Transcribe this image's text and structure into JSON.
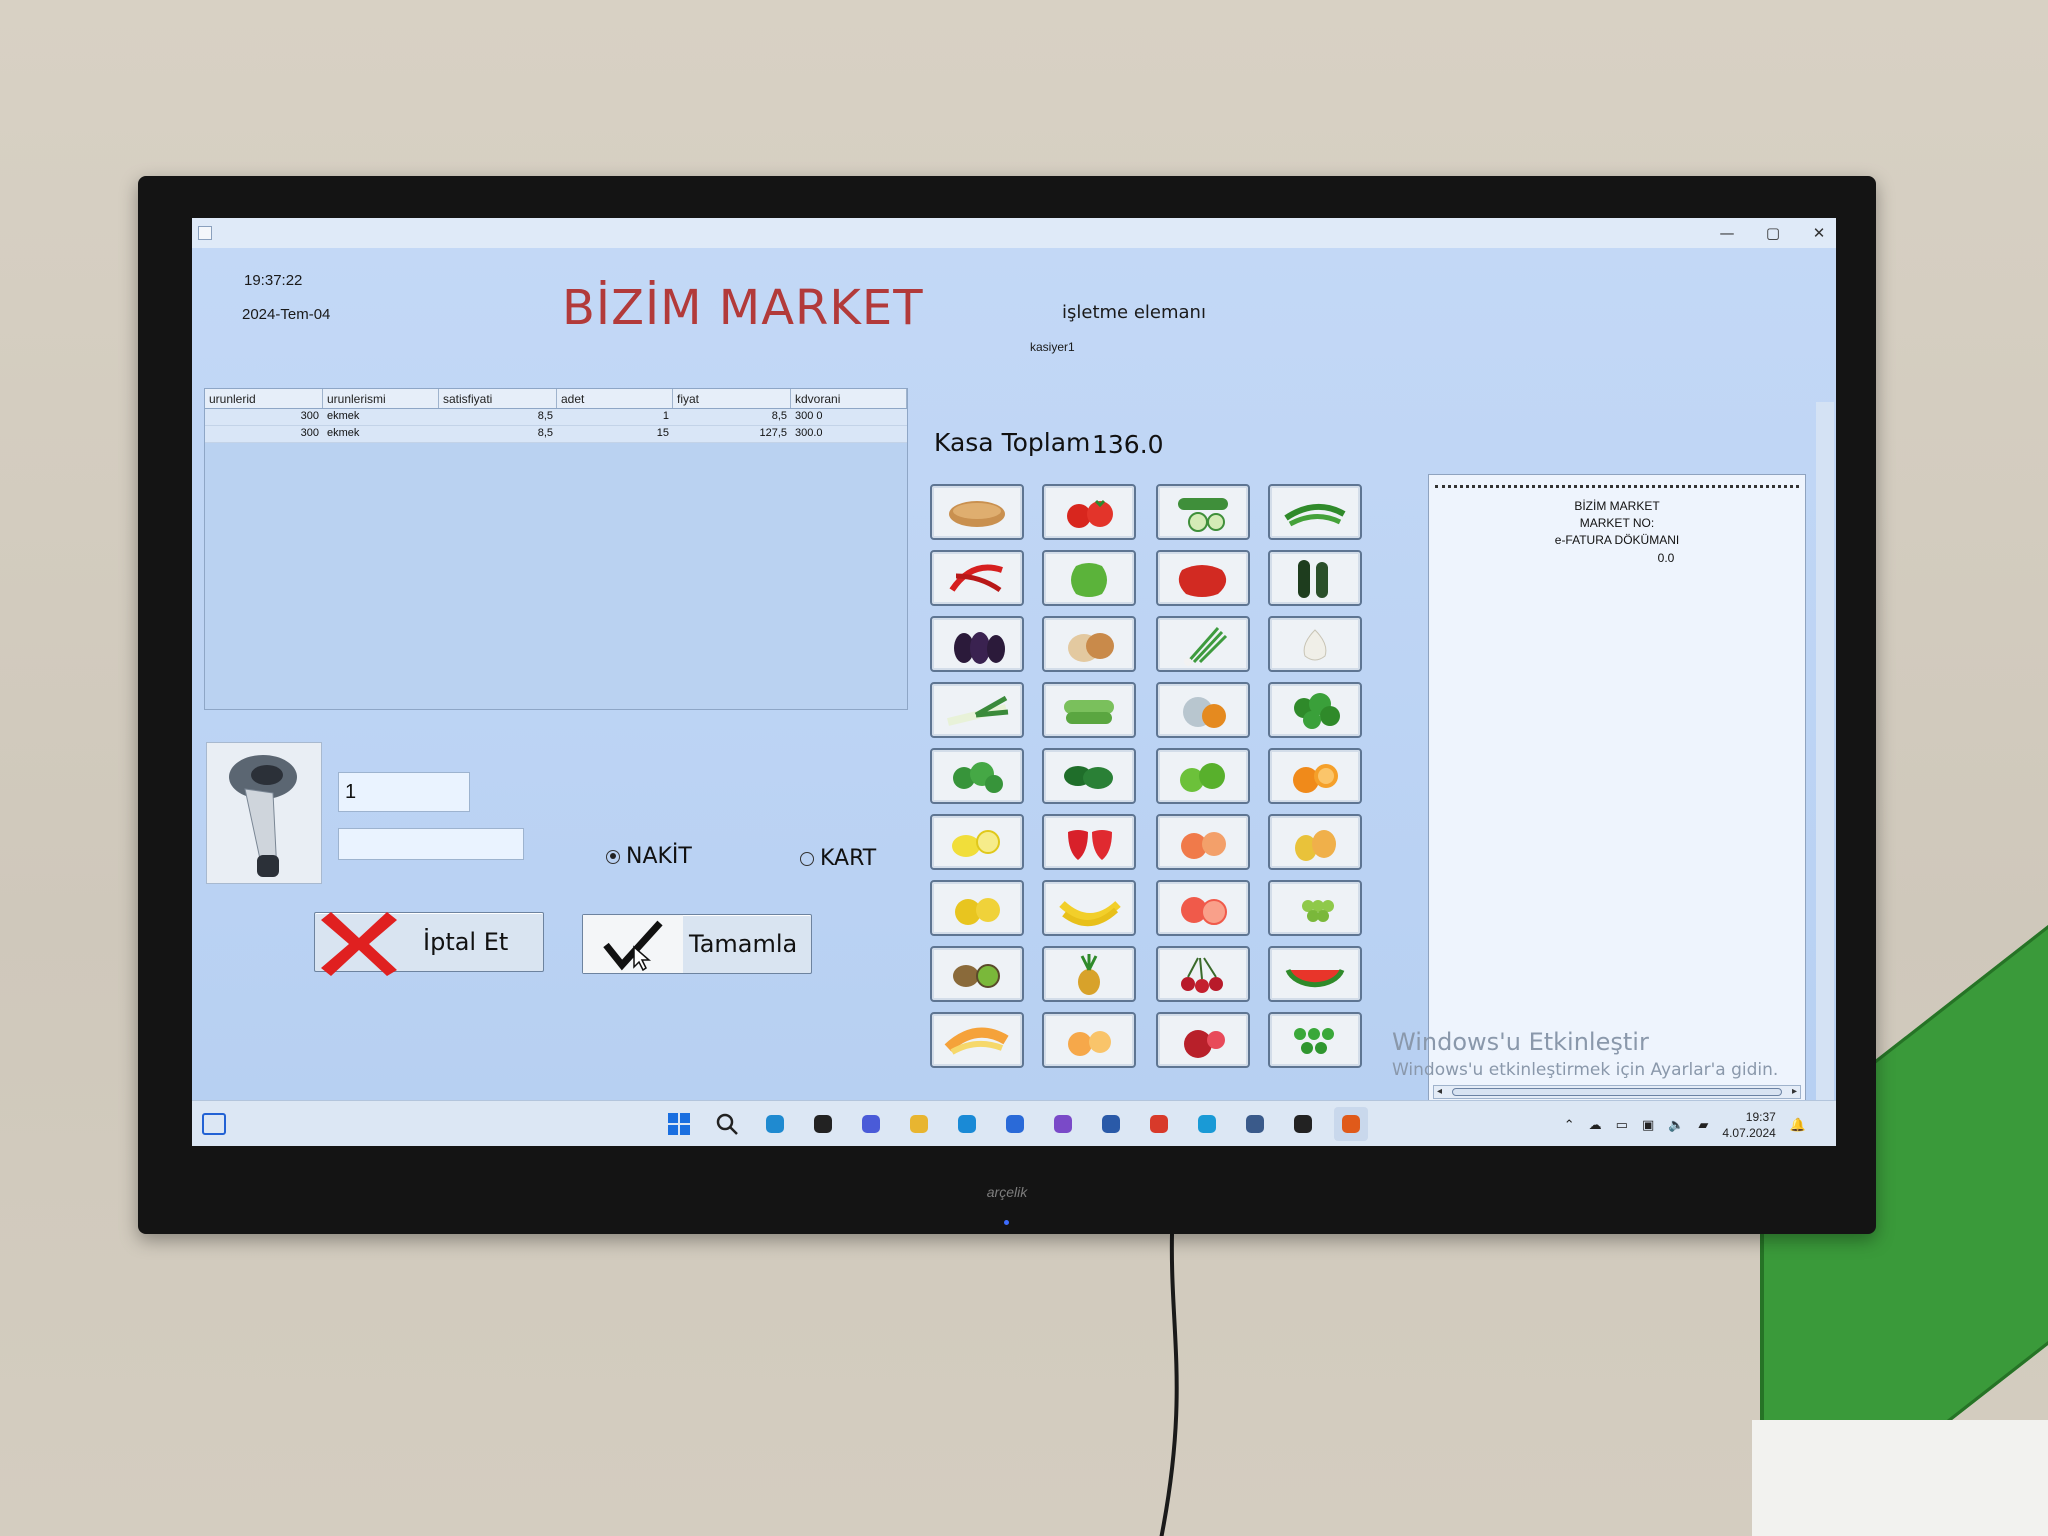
{
  "app": {
    "clock": "19:37:22",
    "date": "2024-Tem-04",
    "title": "BİZİM MARKET",
    "staff_label": "işletme elemanı",
    "staff_name": "kasiyer1"
  },
  "window_controls": {
    "minimize": "—",
    "maximize": "▢",
    "close": "✕"
  },
  "sales_table": {
    "columns": [
      "urunlerid",
      "urunlerismi",
      "satisfiyati",
      "adet",
      "fiyat",
      "kdvorani"
    ],
    "rows": [
      [
        "300",
        "ekmek",
        "8,5",
        "1",
        "8,5",
        "300 0"
      ],
      [
        "300",
        "ekmek",
        "8,5",
        "15",
        "127,5",
        "300.0"
      ]
    ]
  },
  "entry": {
    "quantity": "1",
    "barcode": ""
  },
  "payment": {
    "cash_label": "NAKİT",
    "card_label": "KART",
    "selected": "cash"
  },
  "buttons": {
    "cancel": "İptal Et",
    "complete": "Tamamla"
  },
  "total": {
    "label": "Kasa Toplam",
    "value": "136.0"
  },
  "products": [
    "bread",
    "tomato",
    "cucumber",
    "green-pepper",
    "chili-pepper",
    "bell-pepper",
    "red-pepper",
    "zucchini",
    "eggplant",
    "onion",
    "green-onion",
    "garlic",
    "leek",
    "zucchini-light",
    "pumpkin",
    "parsley",
    "dill",
    "spinach",
    "green-apple",
    "orange",
    "lemon",
    "strawberry",
    "peach",
    "pear",
    "quince",
    "banana",
    "grapefruit",
    "grape",
    "kiwi",
    "pineapple",
    "cherry",
    "watermelon",
    "melon",
    "apricot",
    "pomegranate",
    "peas"
  ],
  "receipt": {
    "line1": "BİZİM MARKET",
    "line2": "MARKET NO:",
    "line3": "e-FATURA DÖKÜMANI",
    "line4": "0.0"
  },
  "activation": {
    "title": "Windows'u Etkinleştir",
    "subtitle": "Windows'u etkinleştirmek için Ayarlar'a gidin."
  },
  "taskbar": {
    "icons": [
      "start-icon",
      "search-icon",
      "widgets-icon",
      "task-view-icon",
      "chat-icon",
      "file-explorer-icon",
      "edge-icon",
      "store-icon",
      "visual-studio-icon",
      "app-icon",
      "chrome-icon",
      "hexagon-app-icon",
      "settings-icon",
      "eye-app-icon",
      "java-icon"
    ],
    "time": "19:37",
    "date": "4.07.2024"
  },
  "tv_brand": "arçelik",
  "colors": {
    "title_red": "#b23a3a",
    "app_bg": "#c3d8f6",
    "cancel_red": "#e02020"
  }
}
